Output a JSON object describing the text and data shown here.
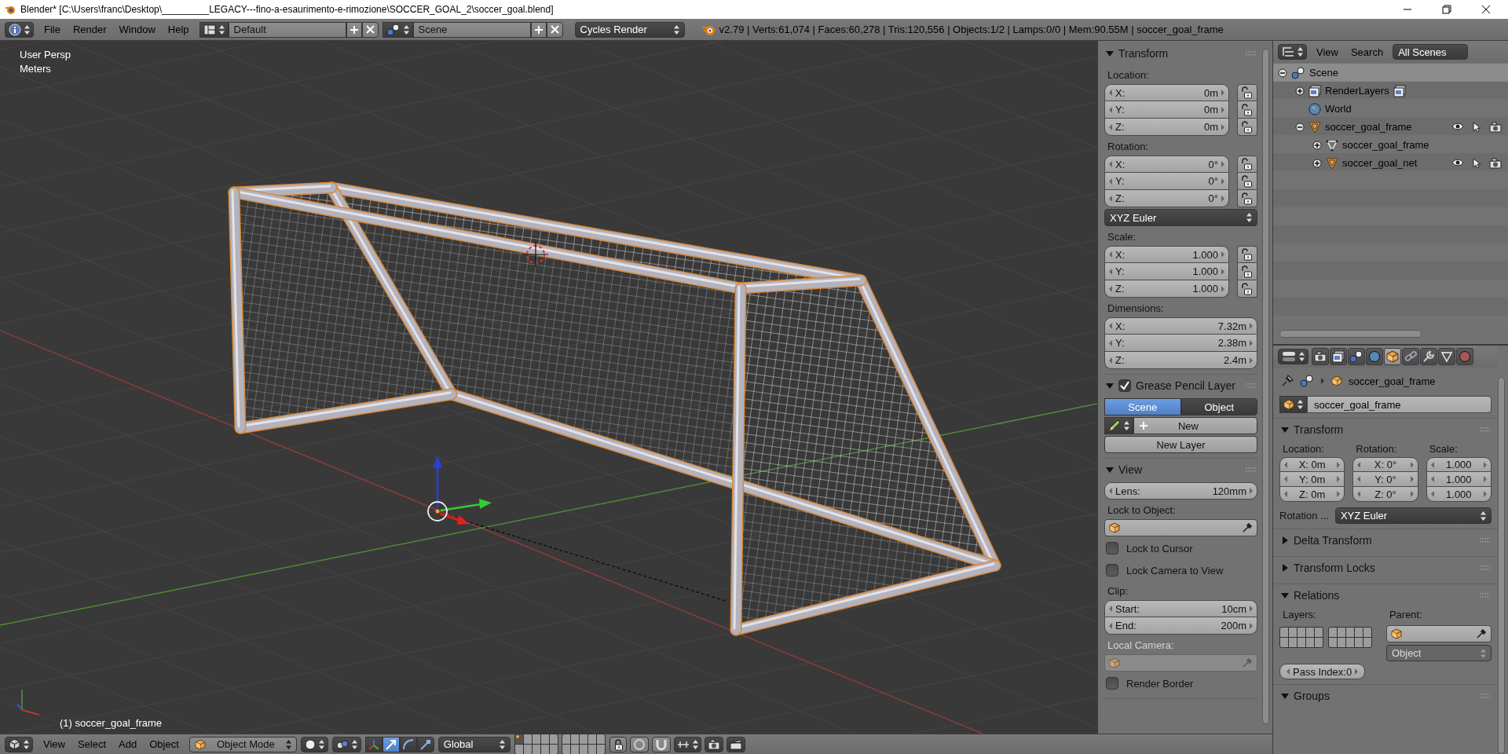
{
  "window": {
    "title": "Blender* [C:\\Users\\franc\\Desktop\\_________LEGACY---fino-a-esaurimento-e-rimozione\\SOCCER_GOAL_2\\soccer_goal.blend]"
  },
  "info_header": {
    "menus": [
      "File",
      "Render",
      "Window",
      "Help"
    ],
    "screen_layout": "Default",
    "scene": "Scene",
    "render_engine": "Cycles Render",
    "stats": "v2.79 | Verts:61,074 | Faces:60,278 | Tris:120,556 | Objects:1/2 | Lamps:0/0 | Mem:90.55M | soccer_goal_frame"
  },
  "viewport": {
    "view_name": "User Persp",
    "units": "Meters",
    "active_object": "(1) soccer_goal_frame"
  },
  "n_panel": {
    "sections": [
      {
        "title": "Transform",
        "expanded": true,
        "rows": [
          {
            "kind": "label",
            "text": "Location:",
            "disabled": false
          },
          {
            "kind": "vector",
            "items": [
              {
                "axis": "X:",
                "value": "0m",
                "locked": false
              },
              {
                "axis": "Y:",
                "value": "0m",
                "locked": false
              },
              {
                "axis": "Z:",
                "value": "0m",
                "locked": false
              }
            ]
          },
          {
            "kind": "label",
            "text": "Rotation:",
            "disabled": false
          },
          {
            "kind": "vector",
            "items": [
              {
                "axis": "X:",
                "value": "0°",
                "locked": false
              },
              {
                "axis": "Y:",
                "value": "0°",
                "locked": false
              },
              {
                "axis": "Z:",
                "value": "0°",
                "locked": false
              }
            ]
          },
          {
            "kind": "dropdown",
            "value": "XYZ Euler"
          },
          {
            "kind": "label",
            "text": "Scale:",
            "disabled": false
          },
          {
            "kind": "vector",
            "items": [
              {
                "axis": "X:",
                "value": "1.000",
                "locked": false
              },
              {
                "axis": "Y:",
                "value": "1.000",
                "locked": false
              },
              {
                "axis": "Z:",
                "value": "1.000",
                "locked": false
              }
            ]
          },
          {
            "kind": "label",
            "text": "Dimensions:",
            "disabled": false
          },
          {
            "kind": "numbers",
            "items": [
              {
                "label": "X:",
                "value": "7.32m"
              },
              {
                "label": "Y:",
                "value": "2.38m"
              },
              {
                "label": "Z:",
                "value": "2.4m"
              }
            ]
          }
        ]
      },
      {
        "title": "Grease Pencil Layer",
        "expanded": true,
        "checked": true,
        "rows": [
          {
            "kind": "toggle",
            "options": [
              {
                "label": "Scene",
                "selected": true
              },
              {
                "label": "Object",
                "selected": false
              }
            ]
          },
          {
            "kind": "datablock",
            "label": "New"
          },
          {
            "kind": "button",
            "label": "New Layer"
          }
        ]
      },
      {
        "title": "View",
        "expanded": true,
        "rows": [
          {
            "kind": "numbers",
            "items": [
              {
                "label": "Lens:",
                "value": "120mm"
              }
            ]
          },
          {
            "kind": "label",
            "text": "Lock to Object:",
            "disabled": false
          },
          {
            "kind": "object_field",
            "disabled": false
          },
          {
            "kind": "checkbox",
            "label": "Lock to Cursor",
            "checked": false
          },
          {
            "kind": "checkbox",
            "label": "Lock Camera to View",
            "checked": false
          },
          {
            "kind": "label",
            "text": "Clip:",
            "disabled": false
          },
          {
            "kind": "numbers",
            "items": [
              {
                "label": "Start:",
                "value": "10cm"
              },
              {
                "label": "End:",
                "value": "200m"
              }
            ]
          },
          {
            "kind": "label",
            "text": "Local Camera:",
            "disabled": true
          },
          {
            "kind": "object_field",
            "disabled": true
          },
          {
            "kind": "checkbox",
            "label": "Render Border",
            "checked": false
          }
        ]
      }
    ]
  },
  "view3d_header": {
    "menus": [
      "View",
      "Select",
      "Add",
      "Object"
    ],
    "mode": "Object Mode",
    "orientation": "Global",
    "manipulators": [
      {
        "kind": "axes",
        "selected": false
      },
      {
        "kind": "translate",
        "selected": true
      },
      {
        "kind": "rotate",
        "selected": false
      },
      {
        "kind": "scale",
        "selected": false
      }
    ],
    "layers": [
      {
        "selected": true,
        "has_objects": true
      },
      {
        "selected": false,
        "has_objects": false
      },
      {
        "selected": false,
        "has_objects": false
      },
      {
        "selected": false,
        "has_objects": false
      },
      {
        "selected": false,
        "has_objects": false
      },
      {
        "selected": false,
        "has_objects": false
      },
      {
        "selected": false,
        "has_objects": false
      },
      {
        "selected": false,
        "has_objects": false
      },
      {
        "selected": false,
        "has_objects": false
      },
      {
        "selected": false,
        "has_objects": false
      },
      {
        "selected": false,
        "has_objects": false
      },
      {
        "selected": false,
        "has_objects": false
      },
      {
        "selected": false,
        "has_objects": false
      },
      {
        "selected": false,
        "has_objects": false
      },
      {
        "selected": false,
        "has_objects": false
      },
      {
        "selected": false,
        "has_objects": false
      },
      {
        "selected": false,
        "has_objects": false
      },
      {
        "selected": false,
        "has_objects": false
      },
      {
        "selected": false,
        "has_objects": false
      },
      {
        "selected": false,
        "has_objects": false
      }
    ]
  },
  "outliner": {
    "menus": [
      "View",
      "Search"
    ],
    "filter": "All Scenes",
    "tree": [
      {
        "label": "Scene",
        "kind": "scene",
        "expanded": true,
        "selected": true,
        "restrict": false,
        "children": [
          {
            "label": "RenderLayers",
            "kind": "render_layers",
            "expanded": false,
            "selected": false,
            "restrict": false
          },
          {
            "label": "World",
            "kind": "world",
            "selected": false,
            "restrict": false
          },
          {
            "label": "soccer_goal_frame",
            "kind": "object",
            "expanded": true,
            "selected": false,
            "restrict": true,
            "children": [
              {
                "label": "soccer_goal_frame",
                "kind": "mesh",
                "expanded": false,
                "selected": false,
                "restrict": false
              },
              {
                "label": "soccer_goal_net",
                "kind": "object",
                "expanded": false,
                "selected": false,
                "restrict": true
              }
            ]
          }
        ]
      }
    ]
  },
  "properties": {
    "context_tabs": [
      {
        "kind": "render",
        "selected": false
      },
      {
        "kind": "render_layers",
        "selected": false
      },
      {
        "kind": "scene",
        "selected": false
      },
      {
        "kind": "world",
        "selected": false
      },
      {
        "kind": "object",
        "selected": true
      },
      {
        "kind": "constraints",
        "selected": false
      },
      {
        "kind": "modifiers",
        "selected": false
      },
      {
        "kind": "data",
        "selected": false
      },
      {
        "kind": "material",
        "selected": false
      }
    ],
    "breadcrumb": "soccer_goal_frame",
    "object_name": "soccer_goal_frame",
    "panels": [
      {
        "title": "Transform",
        "kind": "transform",
        "expanded": true,
        "columns": [
          {
            "label": "Location:",
            "values": [
              {
                "axis": "X:",
                "value": "0m"
              },
              {
                "axis": "Y:",
                "value": "0m"
              },
              {
                "axis": "Z:",
                "value": "0m"
              }
            ]
          },
          {
            "label": "Rotation:",
            "values": [
              {
                "axis": "X:",
                "value": "0°"
              },
              {
                "axis": "Y:",
                "value": "0°"
              },
              {
                "axis": "Z:",
                "value": "0°"
              }
            ]
          },
          {
            "label": "Scale:",
            "values": [
              {
                "value": "1.000"
              },
              {
                "value": "1.000"
              },
              {
                "value": "1.000"
              }
            ]
          }
        ],
        "rotation_mode_label": "Rotation ...",
        "rotation_mode": "XYZ Euler"
      },
      {
        "title": "Delta Transform",
        "kind": "plain",
        "expanded": false
      },
      {
        "title": "Transform Locks",
        "kind": "plain",
        "expanded": false
      },
      {
        "title": "Relations",
        "kind": "relations",
        "expanded": true,
        "layers_label": "Layers:",
        "parent_label": "Parent:",
        "parent_type": "Object",
        "parent_type_disabled": true,
        "pass_index": "Pass Index:0"
      },
      {
        "title": "Groups",
        "kind": "plain",
        "expanded": true
      }
    ]
  }
}
